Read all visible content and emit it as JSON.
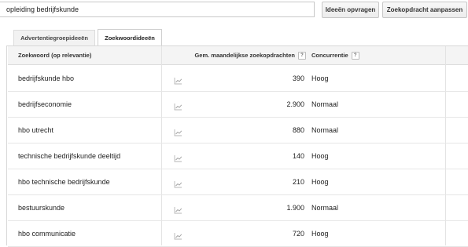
{
  "search": {
    "value": "opleiding bedrijfskunde"
  },
  "buttons": {
    "get_ideas": "Ideeën opvragen",
    "adjust_search": "Zoekopdracht aanpassen"
  },
  "tabs": [
    {
      "label": "Advertentiegroepideeën",
      "active": false
    },
    {
      "label": "Zoekwoordideeën",
      "active": true
    }
  ],
  "table": {
    "headers": {
      "keyword": "Zoekwoord (op relevantie)",
      "volume": "Gem. maandelijkse zoekopdrachten",
      "competition": "Concurrentie",
      "help": "?"
    },
    "rows": [
      {
        "keyword": "bedrijfskunde hbo",
        "volume": "390",
        "competition": "Hoog"
      },
      {
        "keyword": "bedrijfseconomie",
        "volume": "2.900",
        "competition": "Normaal"
      },
      {
        "keyword": "hbo utrecht",
        "volume": "880",
        "competition": "Normaal"
      },
      {
        "keyword": "technische bedrijfskunde deeltijd",
        "volume": "140",
        "competition": "Hoog"
      },
      {
        "keyword": "hbo technische bedrijfskunde",
        "volume": "210",
        "competition": "Hoog"
      },
      {
        "keyword": "bestuurskunde",
        "volume": "1.900",
        "competition": "Normaal"
      },
      {
        "keyword": "hbo communicatie",
        "volume": "720",
        "competition": "Hoog"
      }
    ]
  },
  "icons": {
    "trend": "trend-chart-icon",
    "help": "help-icon"
  },
  "colors": {
    "header_bg": "#f4f4f4",
    "border": "#dcdcdc",
    "button_bg": "#f1f1f1"
  }
}
